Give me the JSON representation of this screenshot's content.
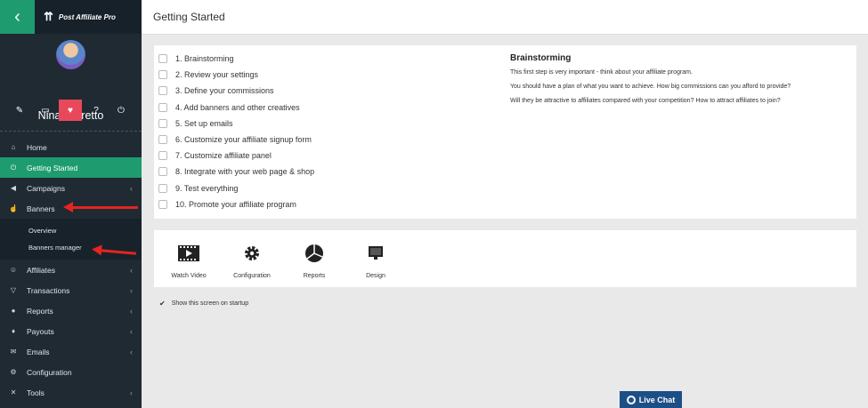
{
  "brand": {
    "name": "Post Affiliate Pro",
    "back_icon": "chevron-left-icon"
  },
  "profile": {
    "name": "Nina Barretto",
    "icons": [
      "pencil-icon",
      "monitor-icon",
      "heart-icon",
      "help-icon",
      "power-icon"
    ],
    "icon_glyphs": [
      "✎",
      "▭",
      "♥",
      "?",
      "⏻"
    ]
  },
  "nav": {
    "home": "Home",
    "getting_started": "Getting Started",
    "campaigns": "Campaigns",
    "banners": "Banners",
    "banners_sub": [
      "Overview",
      "Banners manager"
    ],
    "affiliates": "Affiliates",
    "transactions": "Transactions",
    "reports": "Reports",
    "payouts": "Payouts",
    "emails": "Emails",
    "configuration": "Configuration",
    "tools": "Tools"
  },
  "header": {
    "title": "Getting Started"
  },
  "checklist": [
    "1. Brainstorming",
    "2. Review your settings",
    "3. Define your commissions",
    "4. Add banners and other creatives",
    "5. Set up emails",
    "6. Customize your affiliate signup form",
    "7. Customize affiliate panel",
    "8. Integrate with your web page & shop",
    "9. Test everything",
    "10. Promote your affiliate program"
  ],
  "detail": {
    "title": "Brainstorming",
    "lines": [
      "This first step is very important - think about your affiliate program.",
      "You should have a plan of what you want to achieve. How big commissions can you afford to provide?",
      "Will they be attractive to affiliates compared with your competition? How to attract affiliates to join?"
    ]
  },
  "tools": [
    {
      "label": "Watch Video",
      "icon": "video-icon"
    },
    {
      "label": "Configuration",
      "icon": "gear-icon"
    },
    {
      "label": "Reports",
      "icon": "pie-chart-icon"
    },
    {
      "label": "Design",
      "icon": "monitor-icon"
    }
  ],
  "startup": {
    "label": "Show this screen on startup",
    "checked": true
  },
  "live_chat": {
    "label": "Live Chat"
  },
  "colors": {
    "accent": "#1e9c6f",
    "sidebar": "#1f2a33",
    "highlight": "#e8495a",
    "arrow": "#e52420",
    "chat": "#1c4f86"
  }
}
